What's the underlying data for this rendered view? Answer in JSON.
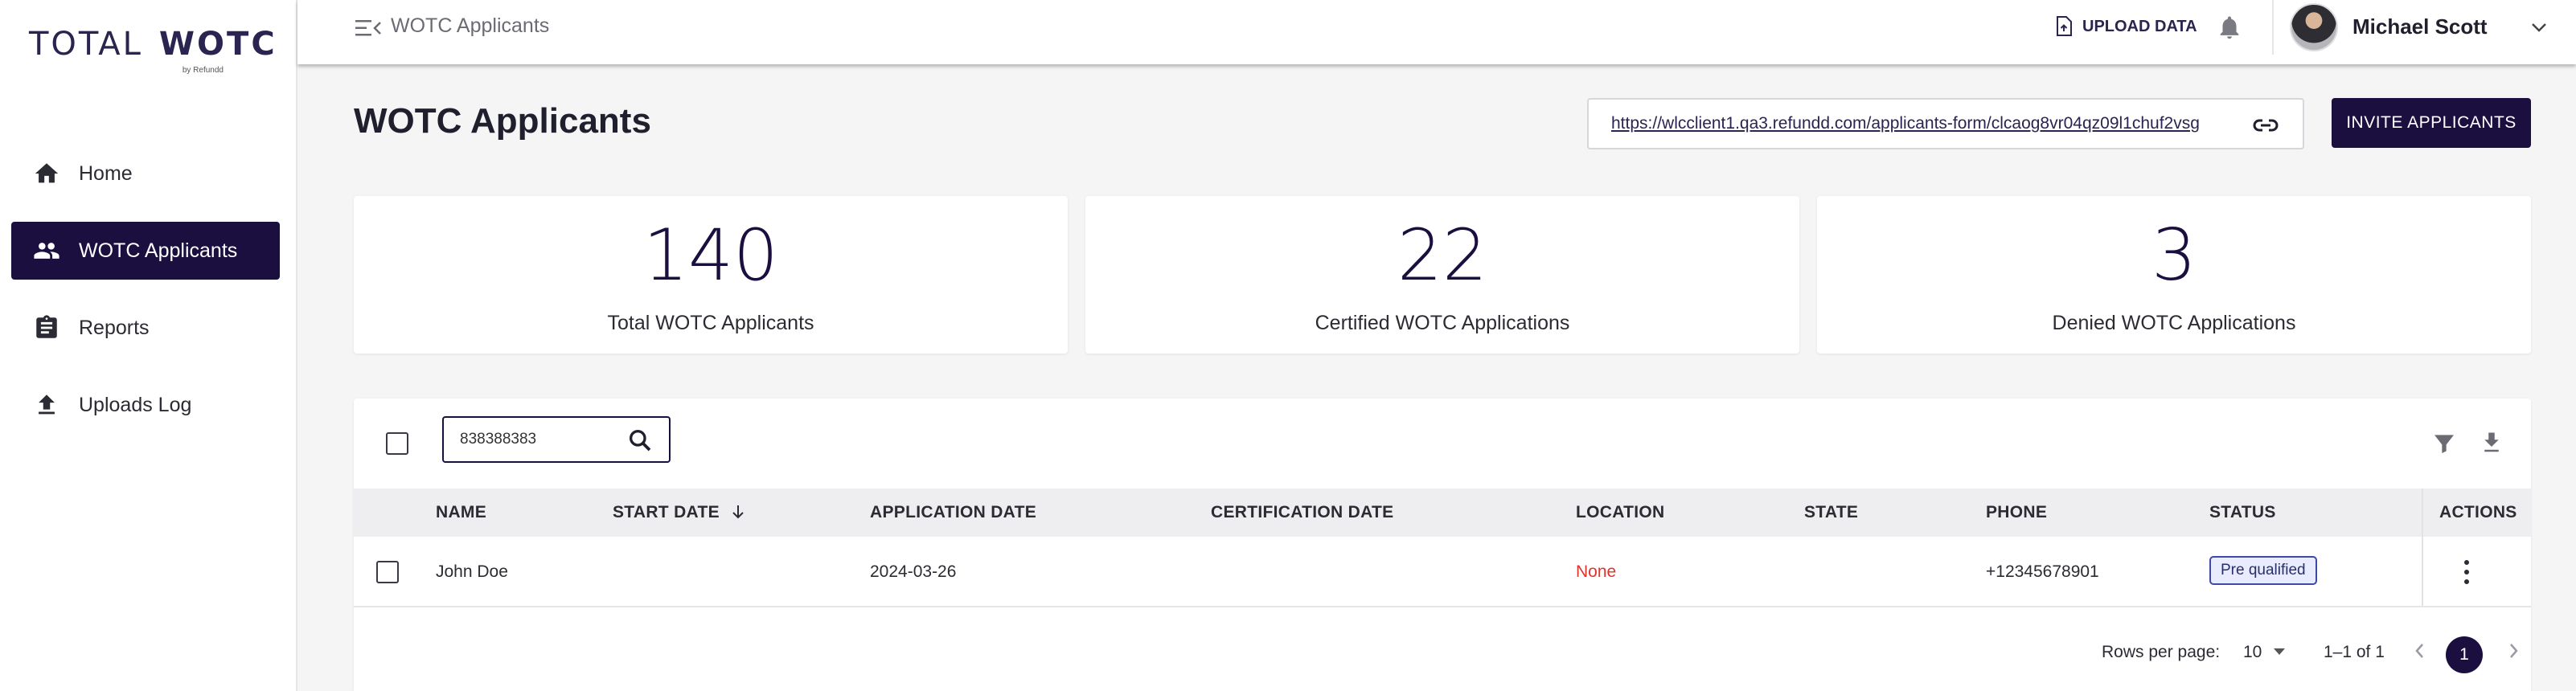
{
  "brand": {
    "total": "TOTAL",
    "wotc": "WOTC",
    "by": "by Refundd"
  },
  "sidebar": {
    "items": [
      {
        "label": "Home",
        "icon": "home-icon"
      },
      {
        "label": "WOTC Applicants",
        "icon": "people-icon",
        "active": true
      },
      {
        "label": "Reports",
        "icon": "clipboard-icon"
      },
      {
        "label": "Uploads Log",
        "icon": "upload-icon"
      }
    ]
  },
  "topbar": {
    "breadcrumb": "WOTC Applicants",
    "upload_label": "UPLOAD DATA",
    "user_name": "Michael Scott"
  },
  "main": {
    "title": "WOTC Applicants",
    "form_link": "https://wlcclient1.qa3.refundd.com/applicants-form/clcaog8vr04qz09l1chuf2vsg",
    "invite_label": "INVITE APPLICANTS",
    "stats": [
      {
        "value": "140",
        "label": "Total WOTC Applicants"
      },
      {
        "value": "22",
        "label": "Certified WOTC Applications"
      },
      {
        "value": "3",
        "label": "Denied WOTC Applications"
      }
    ]
  },
  "table": {
    "search_value": "838388383",
    "columns": {
      "name": "NAME",
      "start_date": "START DATE",
      "application_date": "APPLICATION DATE",
      "certification_date": "CERTIFICATION DATE",
      "location": "LOCATION",
      "state": "STATE",
      "phone": "PHONE",
      "status": "STATUS",
      "actions": "ACTIONS"
    },
    "rows": [
      {
        "name": "John Doe",
        "start_date": "",
        "application_date": "2024-03-26",
        "certification_date": "",
        "location": "None",
        "state": "",
        "phone": "+12345678901",
        "status": "Pre qualified"
      }
    ],
    "pagination": {
      "rows_per_page_label": "Rows per page:",
      "rows_per_page": "10",
      "range": "1–1 of 1",
      "current_page": "1"
    }
  },
  "colors": {
    "primary": "#1b0f3f",
    "accent": "#f15a29",
    "danger": "#e0342c",
    "badge_border": "#3f4aa8"
  }
}
